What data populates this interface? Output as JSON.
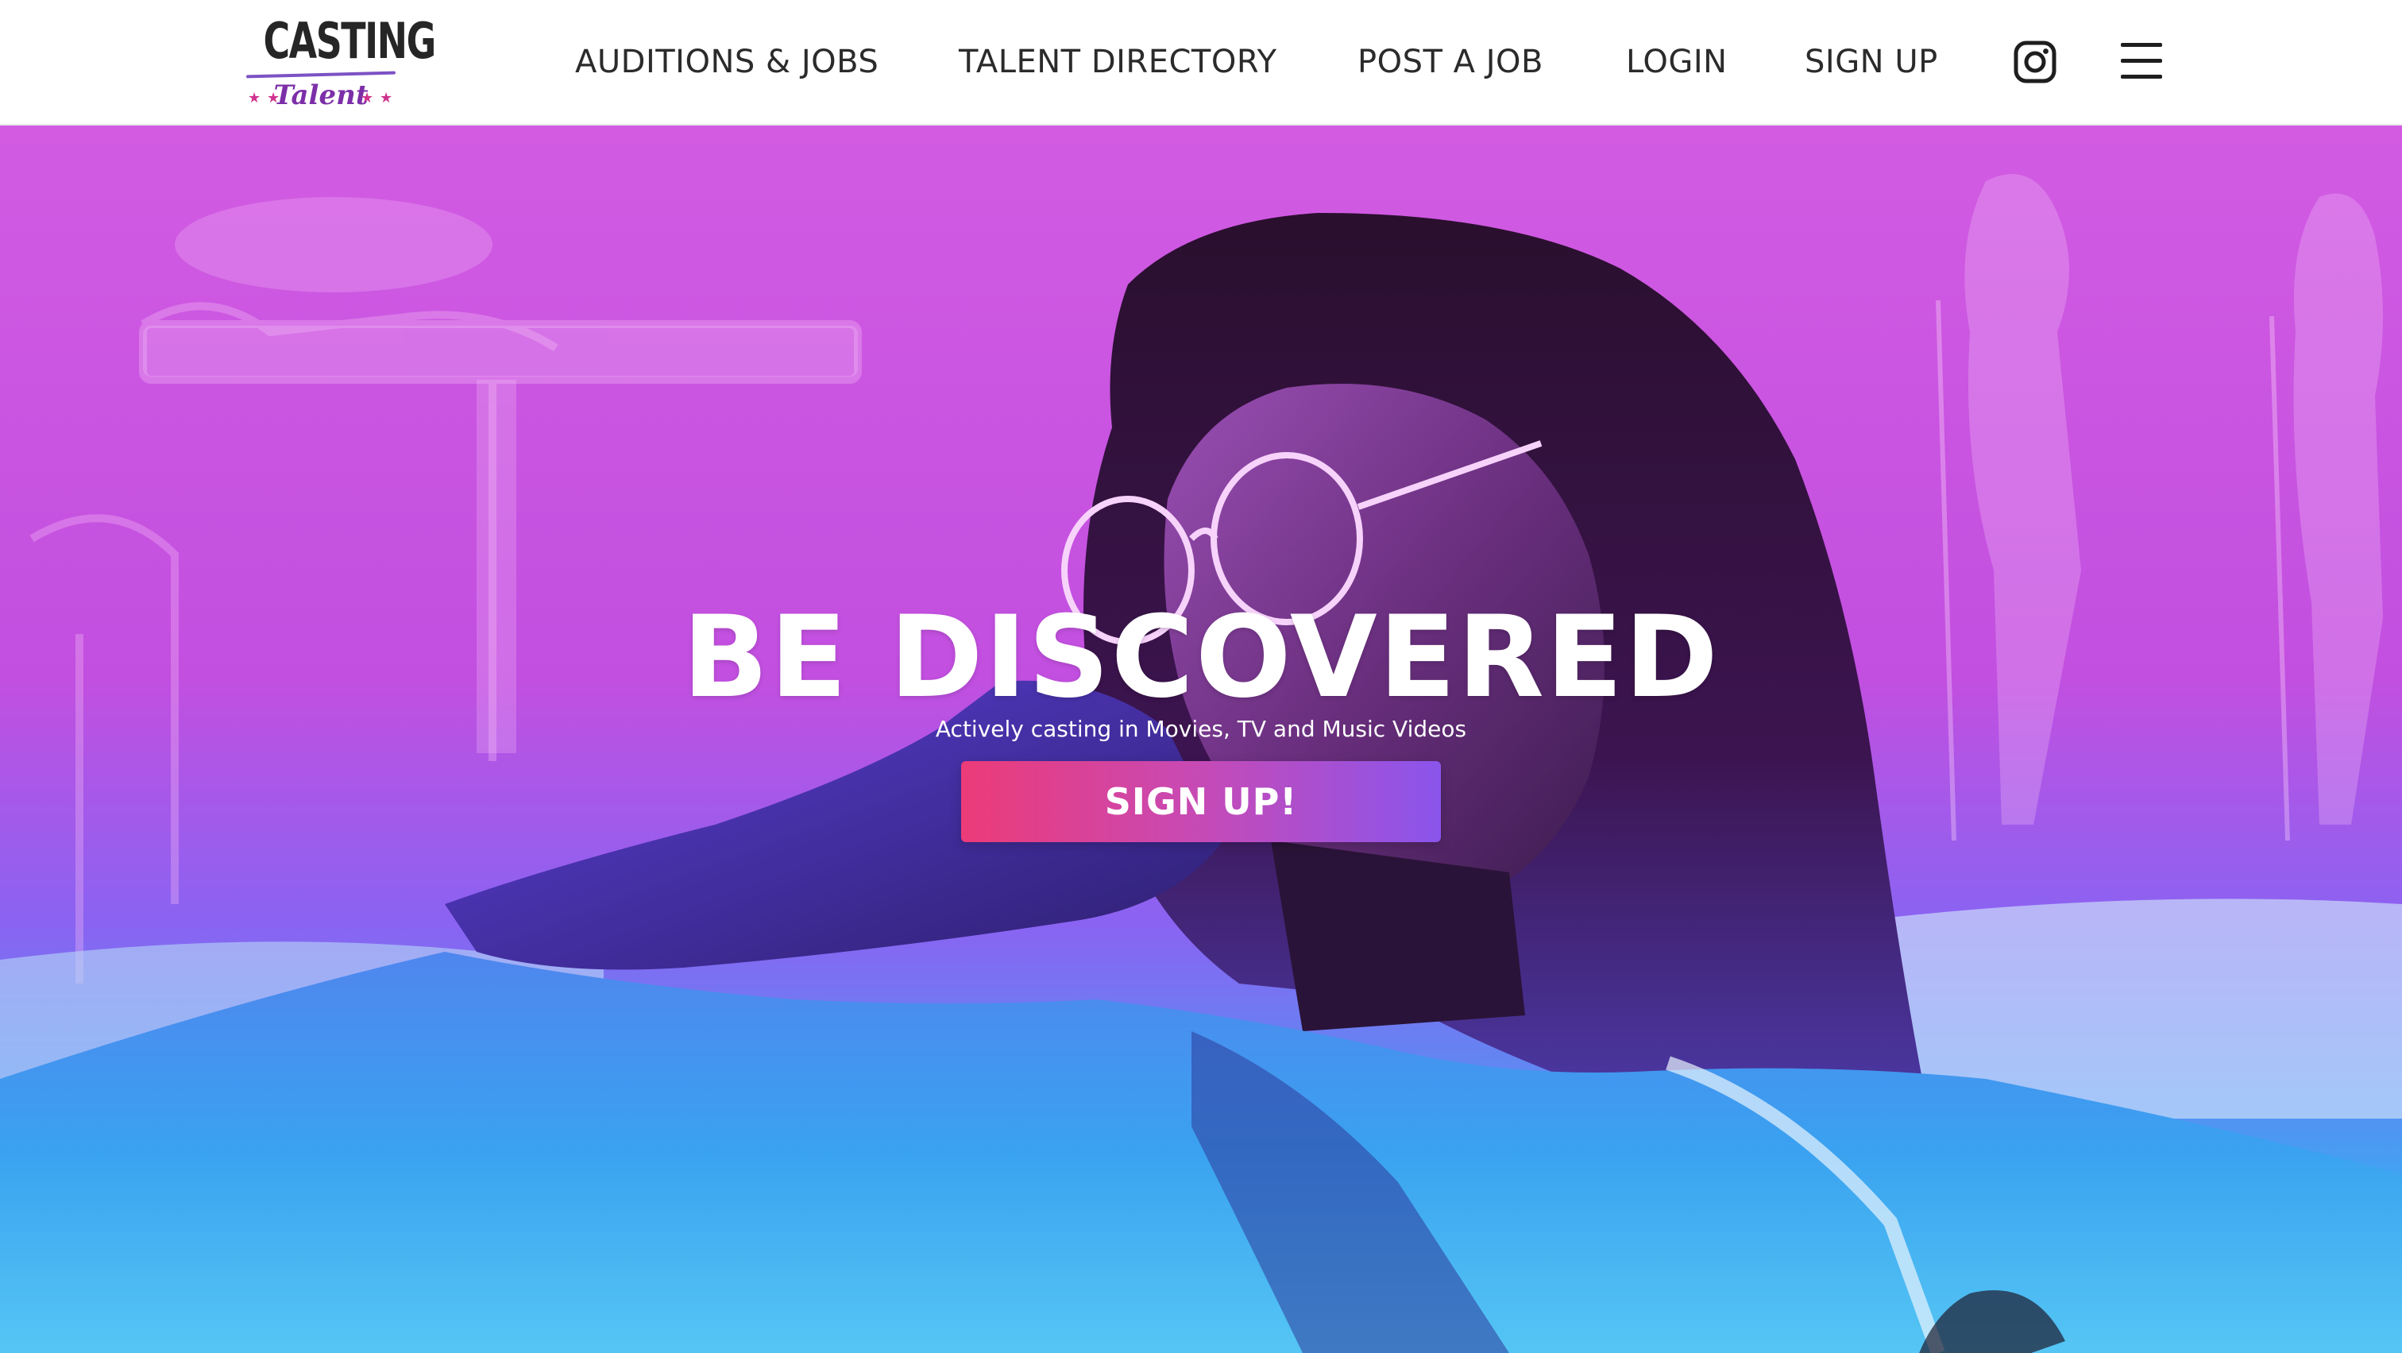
{
  "brand": {
    "logo_word": "CASTING",
    "logo_sub": "Talent",
    "star": "★",
    "accent_purple": "#7c2fa8",
    "accent_pink": "#d0348f"
  },
  "nav": {
    "items": [
      {
        "label": "AUDITIONS & JOBS"
      },
      {
        "label": "TALENT DIRECTORY"
      },
      {
        "label": "POST A JOB"
      },
      {
        "label": "LOGIN"
      },
      {
        "label": "SIGN UP"
      }
    ],
    "instagram_icon": "instagram-icon",
    "menu_icon": "hamburger-menu-icon"
  },
  "hero": {
    "headline": "BE DISCOVERED",
    "subline": "Actively casting in Movies, TV and Music Videos",
    "cta_label": "SIGN UP!",
    "cta_gradient": [
      "#ec3b78",
      "#8a55ec"
    ],
    "background_tint": [
      "#c43fd6",
      "#2ab3ee"
    ]
  }
}
